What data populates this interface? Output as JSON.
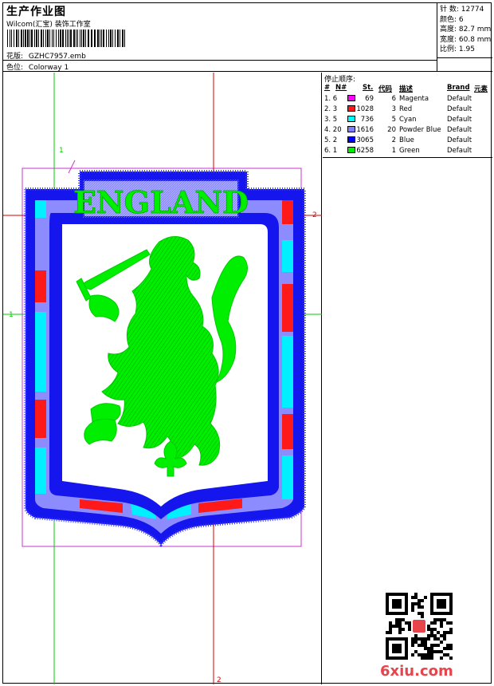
{
  "header": {
    "title": "生产作业图",
    "subtitle": "Wilcom(汇宝) 装饰工作室",
    "pattern_label": "花版:",
    "pattern_value": "GZHC7957.emb",
    "colorway_label": "色位:",
    "colorway_value": "Colorway 1"
  },
  "stats": {
    "stitches": "针 数: 12774",
    "colors": "颜色: 6",
    "height": "高度: 82.7 mm",
    "width": "宽度: 60.8 mm",
    "scale": "比例: 1.95"
  },
  "stop_sequence": {
    "title": "停止顺序:",
    "headers": [
      "#",
      "N#",
      "St.",
      "代码",
      "描述",
      "Brand",
      "元素"
    ],
    "rows": [
      {
        "idx": "1. 6",
        "st": "69",
        "code": "6",
        "desc": "Magenta",
        "brand": "Default",
        "color": "#ff00ff"
      },
      {
        "idx": "2. 3",
        "st": "1028",
        "code": "3",
        "desc": "Red",
        "brand": "Default",
        "color": "#ff1a1a"
      },
      {
        "idx": "3. 5",
        "st": "736",
        "code": "5",
        "desc": "Cyan",
        "brand": "Default",
        "color": "#00ffff"
      },
      {
        "idx": "4. 20",
        "st": "1616",
        "code": "20",
        "desc": "Powder Blue",
        "brand": "Default",
        "color": "#8080ff"
      },
      {
        "idx": "5. 2",
        "st": "3065",
        "code": "2",
        "desc": "Blue",
        "brand": "Default",
        "color": "#0000ff"
      },
      {
        "idx": "6. 1",
        "st": "6258",
        "code": "1",
        "desc": "Green",
        "brand": "Default",
        "color": "#00ee00"
      }
    ]
  },
  "design": {
    "text": "ENGLAND",
    "axis_labels": {
      "left": "1",
      "right": "2",
      "top": "1",
      "bottom": "2"
    }
  },
  "watermark": "6xiu.com",
  "colors": {
    "magenta": "#cc33cc",
    "blue": "#1515ee",
    "powder_blue": "#8c8cff",
    "red": "#ff1a1a",
    "cyan": "#00f0ff",
    "green": "#00ee00",
    "guide_green": "#00cc00",
    "guide_red": "#d40000"
  }
}
